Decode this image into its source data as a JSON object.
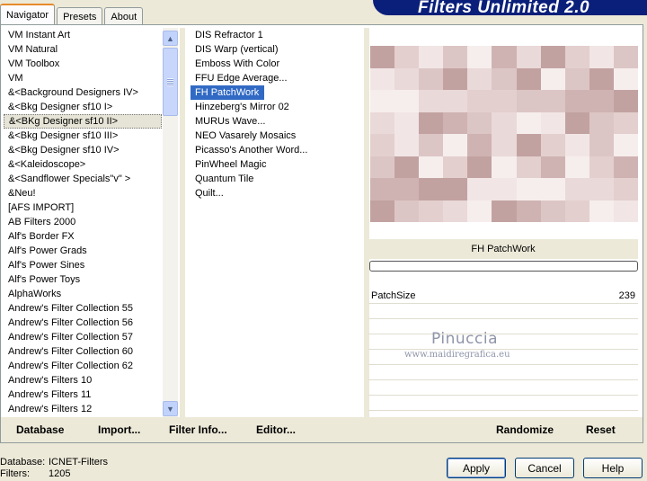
{
  "tabs": [
    {
      "label": "Navigator",
      "active": true
    },
    {
      "label": "Presets",
      "active": false
    },
    {
      "label": "About",
      "active": false
    }
  ],
  "title": "Filters Unlimited 2.0",
  "categories": [
    "VM Instant Art",
    "VM Natural",
    "VM Toolbox",
    "VM",
    "&<Background Designers IV>",
    "&<Bkg Designer sf10 I>",
    "&<BKg Designer sf10 II>",
    "&<Bkg Designer sf10 III>",
    "&<Bkg Designer sf10 IV>",
    "&<Kaleidoscope>",
    "&<Sandflower Specials\"v\" >",
    "&Neu!",
    "[AFS IMPORT]",
    "AB Filters 2000",
    "Alf's Border FX",
    "Alf's Power Grads",
    "Alf's Power Sines",
    "Alf's Power Toys",
    "AlphaWorks",
    "Andrew's Filter Collection 55",
    "Andrew's Filter Collection 56",
    "Andrew's Filter Collection 57",
    "Andrew's Filter Collection 60",
    "Andrew's Filter Collection 62",
    "Andrew's Filters 10",
    "Andrew's Filters 11",
    "Andrew's Filters 12"
  ],
  "selected_category_index": 6,
  "filters": [
    "DIS Refractor 1",
    "DIS Warp (vertical)",
    "Emboss With Color",
    "FFU Edge Average...",
    "FH PatchWork",
    "Hinzeberg's Mirror 02",
    "MURUs Wave...",
    "NEO Vasarely Mosaics",
    "Picasso's Another Word...",
    "PinWheel Magic",
    "Quantum Tile",
    "Quilt..."
  ],
  "selected_filter_index": 4,
  "filter_name": "FH PatchWork",
  "progress": 0,
  "param": {
    "label": "PatchSize",
    "value": "239"
  },
  "watermark": {
    "name": "Pinuccia",
    "url": "www.maidiregrafica.eu"
  },
  "bottom": {
    "database": "Database",
    "import": "Import...",
    "filter_info": "Filter Info...",
    "editor": "Editor...",
    "randomize": "Randomize",
    "reset": "Reset"
  },
  "status": {
    "database_label": "Database:",
    "database_value": "ICNET-Filters",
    "filters_label": "Filters:",
    "filters_value": "1205"
  },
  "buttons": {
    "apply": "Apply",
    "cancel": "Cancel",
    "help": "Help"
  },
  "colors": {
    "selection": "#316ac5",
    "banner": "#0a1f7a",
    "preview": "#c9a9a8"
  }
}
